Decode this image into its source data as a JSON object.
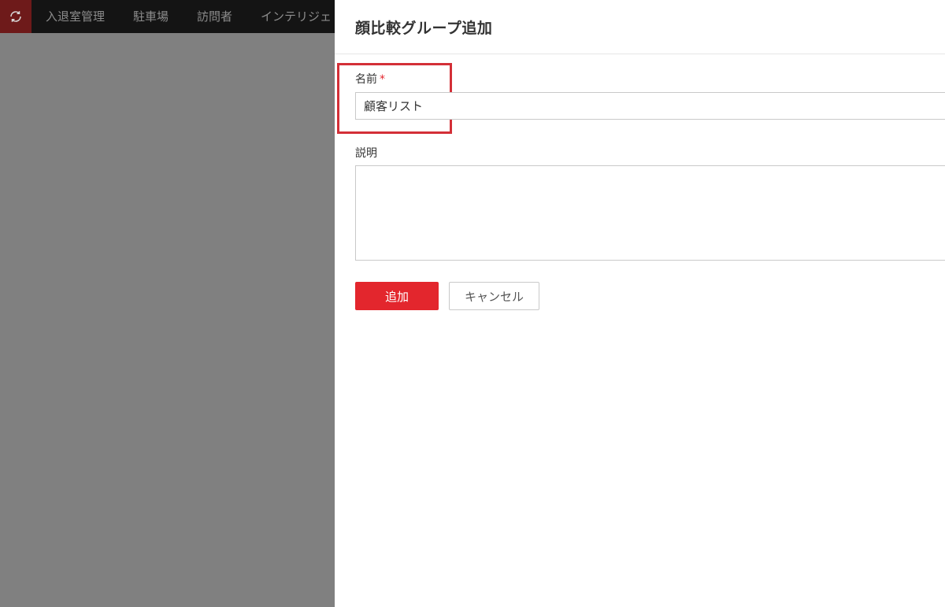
{
  "nav": {
    "items": [
      "入退室管理",
      "駐車場",
      "訪問者",
      "インテリジェ"
    ]
  },
  "panel": {
    "title": "顔比較グループ追加",
    "name_label": "名前",
    "required_mark": "*",
    "name_value": "顧客リスト",
    "description_label": "説明",
    "description_value": "",
    "add_button": "追加",
    "cancel_button": "キャンセル"
  },
  "colors": {
    "accent": "#e3262d",
    "highlight": "#d32f37",
    "topbar": "#141414",
    "backdrop": "#808080"
  },
  "icons": {
    "logo": "refresh-icon"
  }
}
